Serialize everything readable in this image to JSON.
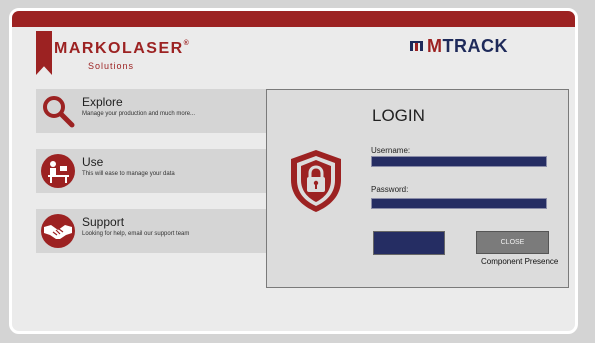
{
  "branding": {
    "company_name": "MARKOLASER",
    "company_reg": "®",
    "company_sub": "Solutions",
    "product_m": "M",
    "product_rest": "TRACK"
  },
  "features": [
    {
      "title": "Explore",
      "description": "Manage your production and much more..."
    },
    {
      "title": "Use",
      "description": "This will ease to manage your data"
    },
    {
      "title": "Support",
      "description": "Looking for help, email our support team"
    }
  ],
  "login": {
    "title": "LOGIN",
    "username_label": "Username:",
    "username_value": "",
    "password_label": "Password:",
    "password_value": "",
    "login_button_label": "",
    "close_button_label": "CLOSE",
    "component_presence": "Component Presence"
  },
  "colors": {
    "brand_red": "#9c2222",
    "navy": "#252d63",
    "panel_gray": "#dcdcdc"
  },
  "icons": [
    "search-icon",
    "user-at-desk-icon",
    "handshake-icon",
    "lock-shield-icon"
  ]
}
